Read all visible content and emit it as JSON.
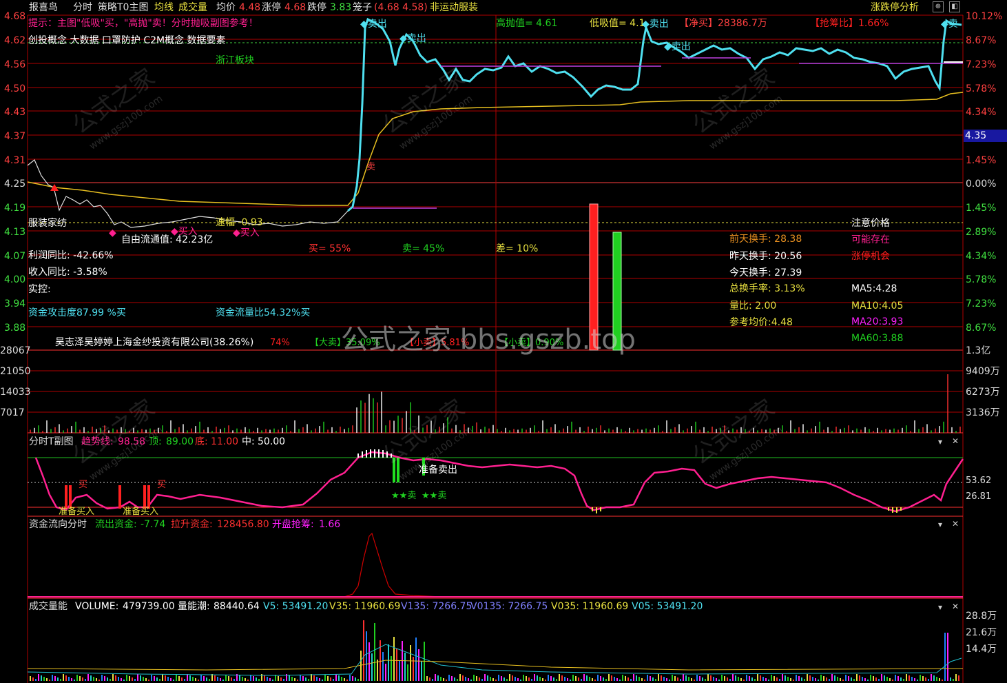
{
  "topbar": {
    "app": "报喜鸟",
    "tab_intraday": "分时",
    "tab_strategy": "策略T0主图",
    "avg_line": "均线",
    "volume": "成交量",
    "avg_price_label": "均价",
    "avg_price": "4.48",
    "limit_up_label": "涨停",
    "limit_up": "4.68",
    "limit_down_label": "跌停",
    "limit_down": "3.83",
    "cage_label": "笼子",
    "cage_value": "(4.68 4.58)",
    "sector_note": "非运动服装",
    "right_title": "涨跌停分析"
  },
  "main": {
    "hint": "提示：主图\"低吸\"买，\"高抛\"卖！分时抛吸副图参考！",
    "concepts": "创投概念 大数据 口罩防护 C2M概念 数据要素",
    "block": "浙江板块",
    "high_sell": "高抛值= 4.61",
    "low_buy": "低吸值= 4.1",
    "net_buy": "【净买】28386.7万",
    "chip_ratio": "【抢筹比】1.66%",
    "industry": "服装家纺",
    "amplitude": "速幅 -0.93",
    "float_cap": "自由流通值: 42.23亿",
    "profit_yoy": "利润同比: -42.66%",
    "revenue_yoy": "收入同比: -3.58%",
    "controller": "实控:",
    "attack": "资金攻击度87.99 %买",
    "flow": "资金流量比54.32%买",
    "holder": "吴志泽吴婷婷上海金纱投资有限公司(38.26%)",
    "sub_big_sell": "【大卖】35.09%",
    "sub_small_sell": "【小卖】5.81%",
    "sub_tiny_sell": "【小卖】0.90%",
    "sub_pct": "74%",
    "buy_pct": "买= 55%",
    "sell_pct": "卖= 45%",
    "diff_pct": "差= 10%",
    "watch_price": "注意价格",
    "may_exist": "可能存在",
    "limit_chance": "涨停机会",
    "turn_prev2": "前天换手: 28.38",
    "turn_prev1": "昨天换手: 20.56",
    "turn_today": "今天换手: 27.39",
    "turn_total": "总换手率: 3.13%",
    "vol_ratio": "量比: 2.00",
    "ref_avg": "参考均价:4.48",
    "ma5": "MA5:4.28",
    "ma10": "MA10:4.05",
    "ma20": "MA20:3.93",
    "ma60": "MA60:3.88",
    "watermark_main": "公式之家 bbs.gszb.top",
    "watermark_site": "www.gszj100.com",
    "watermark_cn": "公式之家",
    "sell_tag": "卖出",
    "buy_tag": "买入",
    "sell_short": "卖",
    "ymax_tag": "4.35",
    "price_axis": [
      "4.68",
      "4.62",
      "4.56",
      "4.50",
      "4.43",
      "4.37",
      "4.31",
      "4.25",
      "4.19",
      "4.13",
      "4.07",
      "4.00",
      "3.94",
      "3.88"
    ],
    "pct_axis": [
      "10.12%",
      "8.67%",
      "7.23%",
      "5.78%",
      "4.34%",
      "2.89%",
      "1.45%",
      "0.00%",
      "1.45%",
      "2.89%",
      "4.34%",
      "5.78%",
      "7.23%",
      "8.67%"
    ]
  },
  "volume_panel": {
    "left_axis": [
      "28067",
      "21050",
      "14033",
      "7017"
    ],
    "right_axis": [
      "1.3亿",
      "9409万",
      "6273万",
      "3136万"
    ]
  },
  "t_panel": {
    "title": "分时T副图",
    "trend_label": "趋势线:",
    "trend_value": "98.58",
    "top_label": "顶:",
    "top_value": "89.00",
    "bottom_label": "底:",
    "bottom_value": "11.00",
    "mid_label": "中:",
    "mid_value": "50.00",
    "ready_sell": "准备卖出",
    "ready_buy": "准备买入",
    "buy_mark": "买",
    "sell_mark": "卖",
    "axis_hi": "53.62",
    "axis_lo": "26.81"
  },
  "flow_panel": {
    "title": "资金流向分时",
    "out_label": "流出资金:",
    "out_value": "-7.74",
    "pull_label": "拉升资金:",
    "pull_value": "128456.80",
    "open_label": "开盘抢筹:",
    "open_value": "1.66"
  },
  "vol_energy": {
    "title": "成交量能",
    "volume_label": "VOLUME:",
    "volume_value": "479739.00",
    "tide_label": "量能潮:",
    "tide_value": "88440.64",
    "v5": "V5: 53491.20",
    "v35": "V35: 11960.69",
    "v135": "V135: 7266.75",
    "v0135": "V0135: 7266.75",
    "v035": "V035: 11960.69",
    "v05": "V05: 53491.20",
    "axis": [
      "28.8万",
      "21.6万",
      "14.4万"
    ]
  },
  "colors": {
    "price_line": "#4fe0f0",
    "avg_line": "#e8c020",
    "grid": "#c00000",
    "magenta": "#ff2090",
    "green": "#00d000",
    "red": "#ff2020",
    "yellow": "#e8e040"
  }
}
